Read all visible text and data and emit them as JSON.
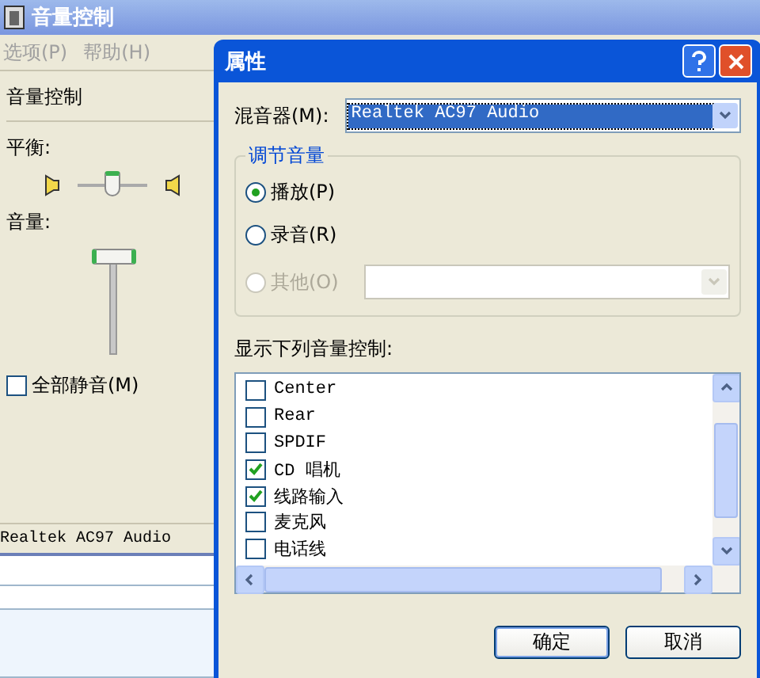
{
  "main_window": {
    "title": "音量控制",
    "active": false,
    "menu": [
      "选项(P)",
      "帮助(H)"
    ],
    "panel": {
      "title": "音量控制",
      "balance_label": "平衡:",
      "balance": {
        "level": 0.5
      },
      "volume_label": "音量:",
      "volume": {
        "level": 0.95
      },
      "mute": {
        "label": "全部静音(M)",
        "checked": false
      }
    },
    "status_bar": "Realtek AC97 Audio"
  },
  "dialog": {
    "title": "属性",
    "mixer_label": "混音器(M):",
    "mixer_value": "Realtek AC97 Audio",
    "group_title": "调节音量",
    "radios": [
      {
        "label": "播放(P)",
        "selected": true,
        "disabled": false
      },
      {
        "label": "录音(R)",
        "selected": false,
        "disabled": false
      },
      {
        "label": "其他(O)",
        "selected": false,
        "disabled": true
      }
    ],
    "list_label": "显示下列音量控制:",
    "controls": [
      {
        "label": "Center",
        "checked": false
      },
      {
        "label": "Rear",
        "checked": false
      },
      {
        "label": "SPDIF",
        "checked": false
      },
      {
        "label": "CD 唱机",
        "checked": true
      },
      {
        "label": "线路输入",
        "checked": true
      },
      {
        "label": "麦克风",
        "checked": false
      },
      {
        "label": "电话线",
        "checked": false
      }
    ],
    "buttons": [
      "确定",
      "取消"
    ]
  }
}
